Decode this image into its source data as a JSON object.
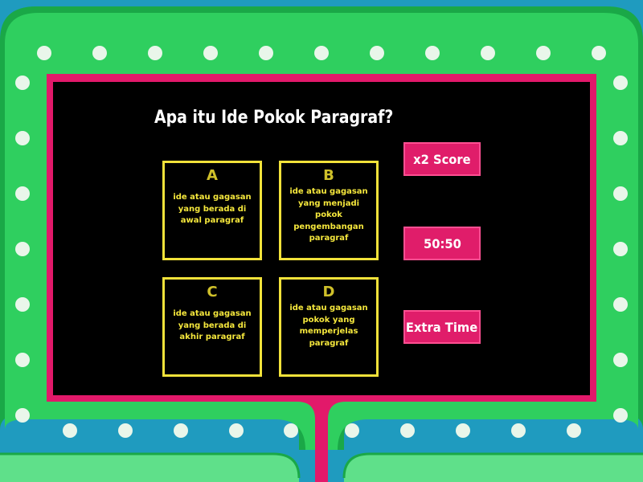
{
  "colors": {
    "background": "#1f9bbf",
    "frame_outer": "#1bb64a",
    "frame_inner": "#2fd261",
    "bulb": "#e9f6ea",
    "border_magenta": "#e2196a",
    "screen": "#000000",
    "answer_border": "#f2e23a",
    "answer_text": "#f5e73c",
    "powerup_bg": "#e01d6a"
  },
  "question": "Apa itu Ide Pokok Paragraf?",
  "answers": [
    {
      "letter": "A",
      "text": "ide atau gagasan yang berada di awal paragraf"
    },
    {
      "letter": "B",
      "text": "ide atau gagasan yang menjadi pokok pengembangan paragraf"
    },
    {
      "letter": "C",
      "text": "ide atau gagasan yang berada di akhir paragraf"
    },
    {
      "letter": "D",
      "text": "ide atau gagasan pokok yang memperjelas paragraf"
    }
  ],
  "powerups": {
    "double_score": "x2 Score",
    "fifty_fifty": "50:50",
    "extra_time": "Extra Time"
  }
}
